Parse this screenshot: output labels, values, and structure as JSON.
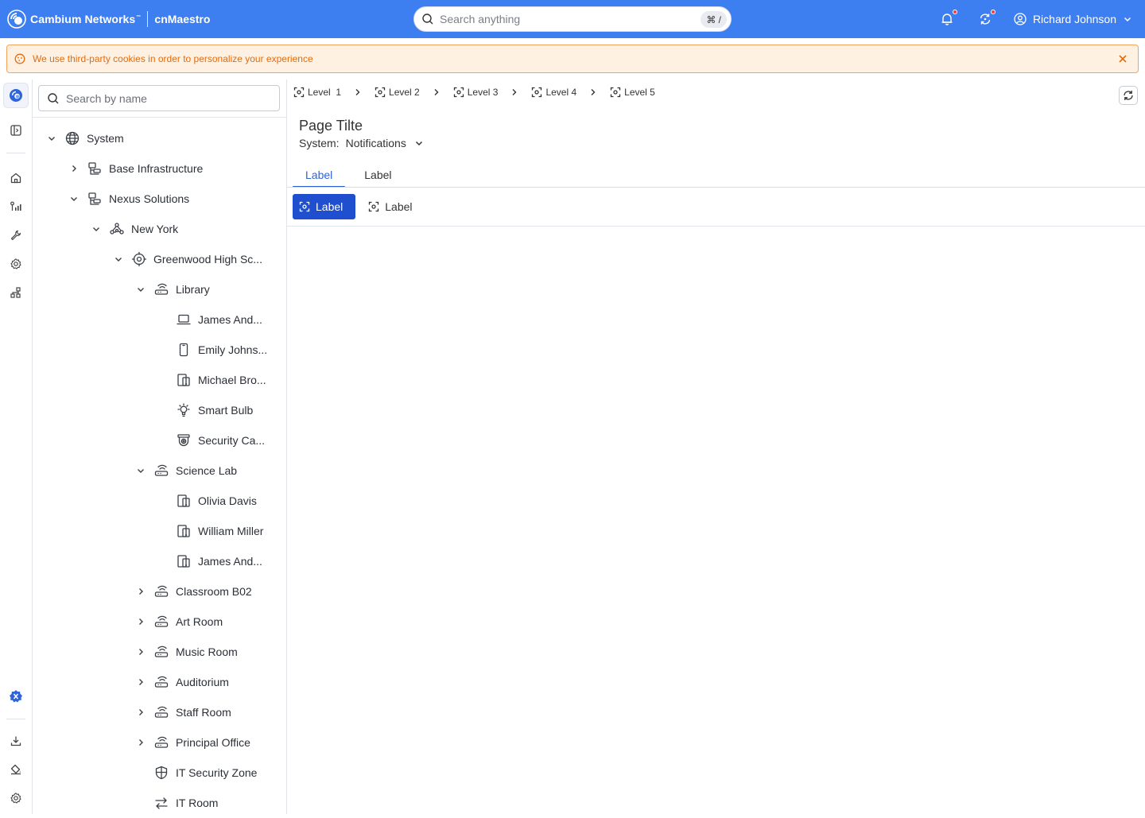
{
  "app": {
    "brand": "Cambium Networks",
    "brand_tm": "™",
    "product": "cnMaestro"
  },
  "header": {
    "search_placeholder": "Search anything",
    "search_shortcut": "⌘ /",
    "user_name": "Richard Johnson",
    "accent_color": "#3d7ff0"
  },
  "cookie_banner": {
    "text": "We use third-party cookies in order to personalize your experience"
  },
  "tree_panel": {
    "search_placeholder": "Search by name",
    "nodes": [
      {
        "label": "System",
        "icon": "globe-icon",
        "expanded": true
      },
      {
        "label": "Base Infrastructure",
        "icon": "organization-icon",
        "expanded": false
      },
      {
        "label": "Nexus Solutions",
        "icon": "organization-icon",
        "expanded": true
      },
      {
        "label": "New York",
        "icon": "network-icon",
        "expanded": true
      },
      {
        "label": "Greenwood High Sc...",
        "icon": "site-icon",
        "expanded": true
      },
      {
        "label": "Library",
        "icon": "router-icon",
        "expanded": true
      },
      {
        "label": "James And...",
        "icon": "laptop-icon"
      },
      {
        "label": "Emily Johns...",
        "icon": "phone-icon"
      },
      {
        "label": "Michael Bro...",
        "icon": "devices-icon"
      },
      {
        "label": "Smart Bulb",
        "icon": "bulb-icon"
      },
      {
        "label": "Security Ca...",
        "icon": "camera-icon"
      },
      {
        "label": "Science Lab",
        "icon": "router-icon",
        "expanded": true
      },
      {
        "label": "Olivia Davis",
        "icon": "devices-icon"
      },
      {
        "label": "William Miller",
        "icon": "devices-icon"
      },
      {
        "label": "James And...",
        "icon": "devices-icon"
      },
      {
        "label": "Classroom B02",
        "icon": "router-icon",
        "expanded": false
      },
      {
        "label": "Art Room",
        "icon": "router-icon",
        "expanded": false
      },
      {
        "label": "Music Room",
        "icon": "router-icon",
        "expanded": false
      },
      {
        "label": "Auditorium",
        "icon": "router-icon",
        "expanded": false
      },
      {
        "label": "Staff Room",
        "icon": "router-icon",
        "expanded": false
      },
      {
        "label": "Principal Office",
        "icon": "router-icon",
        "expanded": false
      },
      {
        "label": "IT Security Zone",
        "icon": "shield-icon"
      },
      {
        "label": "IT Room",
        "icon": "swap-icon"
      }
    ]
  },
  "breadcrumb": [
    "Level  1",
    "Level 2",
    "Level 3",
    "Level 4",
    "Level 5"
  ],
  "page": {
    "title": "Page Tilte",
    "system_label": "System:",
    "system_value": "Notifications"
  },
  "tabs": [
    {
      "label": "Label",
      "active": true
    },
    {
      "label": "Label",
      "active": false
    }
  ],
  "toolbar": [
    {
      "label": "Label",
      "primary": true
    },
    {
      "label": "Label",
      "primary": false
    }
  ]
}
